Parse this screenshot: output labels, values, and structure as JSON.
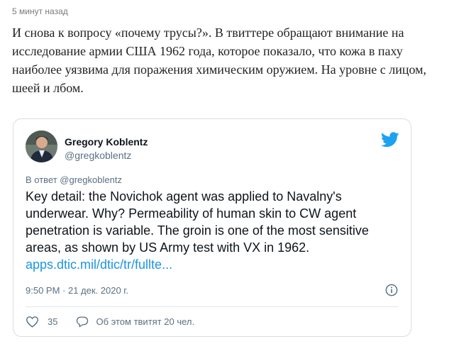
{
  "post": {
    "time": "5 минут назад",
    "text": "И снова к вопросу «почему трусы?». В твиттере обращают внимание на исследование армии США 1962 года, которое показало, что кожа в паху наиболее уязвима для поражения химическим оружием. На уровне с лицом, шеей и лбом."
  },
  "tweet": {
    "author_name": "Gregory Koblentz",
    "author_handle": "@gregkoblentz",
    "reply_to": "В ответ @gregkoblentz",
    "body": "Key detail: the Novichok agent was applied to Navalny's underwear. Why? Permeability of human skin to CW agent penetration is variable. The groin is one of the most sensitive areas, as shown by US Army test with VX in 1962.",
    "link": "apps.dtic.mil/dtic/tr/fullte...",
    "timestamp": "9:50 PM · 21 дек. 2020 г.",
    "like_count": "35",
    "discussion": "Об этом твитят 20 чел.",
    "accent_color": "#1b95e0",
    "icons": [
      "avatar",
      "twitter-bird-icon",
      "info-icon",
      "heart-icon",
      "comment-icon"
    ]
  }
}
